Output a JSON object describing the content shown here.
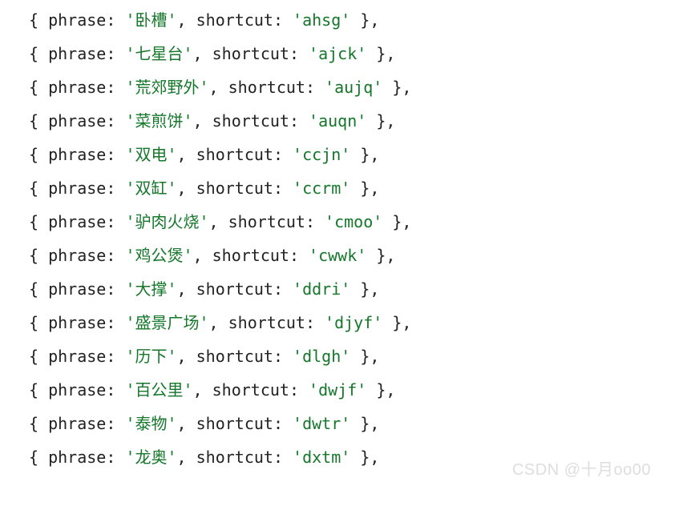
{
  "code": {
    "key_phrase": "phrase",
    "key_shortcut": "shortcut",
    "entries": [
      {
        "phrase": "卧槽",
        "shortcut": "ahsg"
      },
      {
        "phrase": "七星台",
        "shortcut": "ajck"
      },
      {
        "phrase": "荒郊野外",
        "shortcut": "aujq"
      },
      {
        "phrase": "菜煎饼",
        "shortcut": "auqn"
      },
      {
        "phrase": "双电",
        "shortcut": "ccjn"
      },
      {
        "phrase": "双缸",
        "shortcut": "ccrm"
      },
      {
        "phrase": "驴肉火烧",
        "shortcut": "cmoo"
      },
      {
        "phrase": "鸡公煲",
        "shortcut": "cwwk"
      },
      {
        "phrase": "大撑",
        "shortcut": "ddri"
      },
      {
        "phrase": "盛景广场",
        "shortcut": "djyf"
      },
      {
        "phrase": "历下",
        "shortcut": "dlgh"
      },
      {
        "phrase": "百公里",
        "shortcut": "dwjf"
      },
      {
        "phrase": "泰物",
        "shortcut": "dwtr"
      },
      {
        "phrase": "龙奥",
        "shortcut": "dxtm"
      }
    ]
  },
  "watermark": "CSDN @十月oo00"
}
